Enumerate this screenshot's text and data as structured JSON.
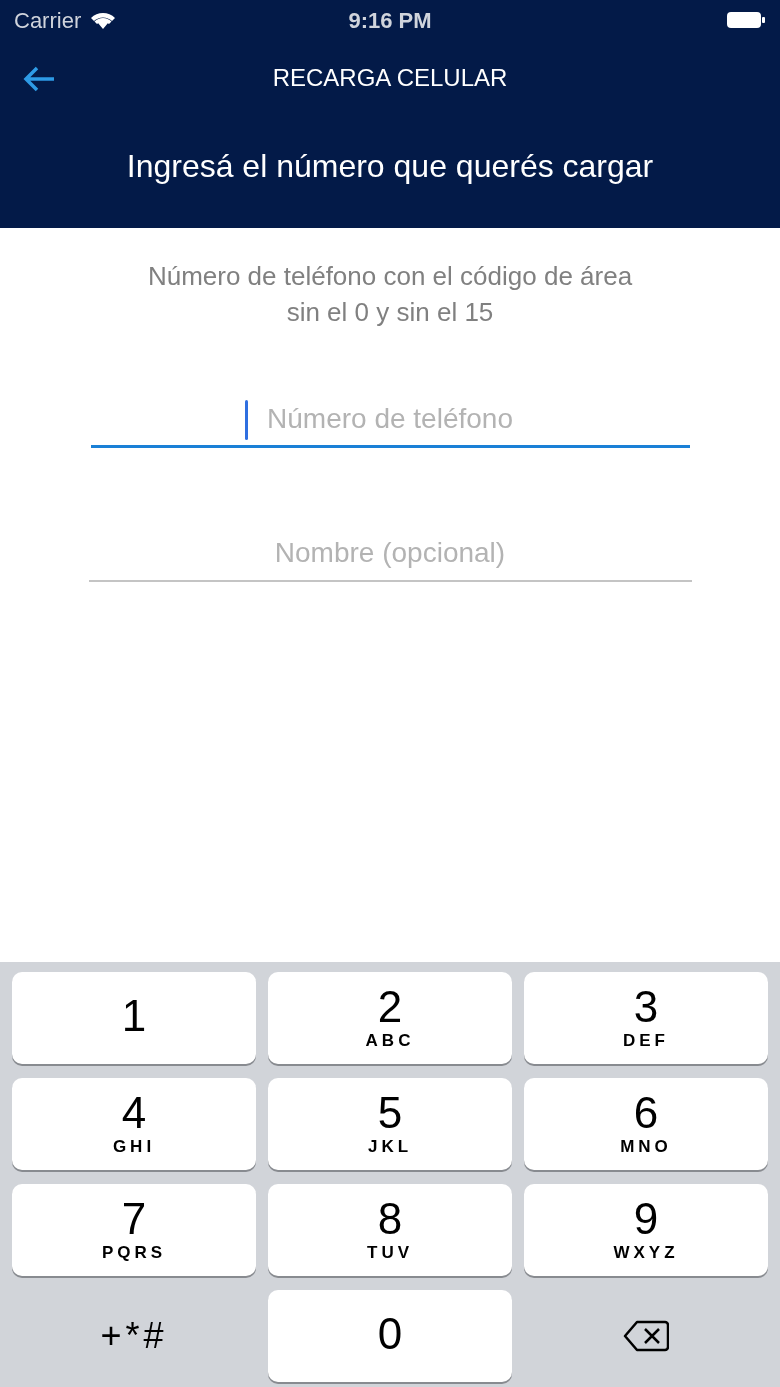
{
  "status_bar": {
    "carrier": "Carrier",
    "time": "9:16 PM"
  },
  "nav": {
    "title": "RECARGA CELULAR"
  },
  "header": {
    "text": "Ingresá el número que querés cargar"
  },
  "instructions": "Número de teléfono con el código de área sin el 0 y sin el 15",
  "fields": [
    {
      "placeholder": "Número de teléfono",
      "focused": true
    },
    {
      "placeholder": "Nombre (opcional)",
      "focused": false
    }
  ],
  "keypad": {
    "keys": [
      {
        "kind": "digit",
        "digit": "1"
      },
      {
        "kind": "digit",
        "digit": "2",
        "letters": "ABC"
      },
      {
        "kind": "digit",
        "digit": "3",
        "letters": "DEF"
      },
      {
        "kind": "digit",
        "digit": "4",
        "letters": "GHI"
      },
      {
        "kind": "digit",
        "digit": "5",
        "letters": "JKL"
      },
      {
        "kind": "digit",
        "digit": "6",
        "letters": "MNO"
      },
      {
        "kind": "digit",
        "digit": "7",
        "letters": "PQRS"
      },
      {
        "kind": "digit",
        "digit": "8",
        "letters": "TUV"
      },
      {
        "kind": "digit",
        "digit": "9",
        "letters": "WXYZ"
      },
      {
        "kind": "symbols",
        "label": "+*#"
      },
      {
        "kind": "digit",
        "digit": "0"
      },
      {
        "kind": "delete"
      }
    ]
  }
}
